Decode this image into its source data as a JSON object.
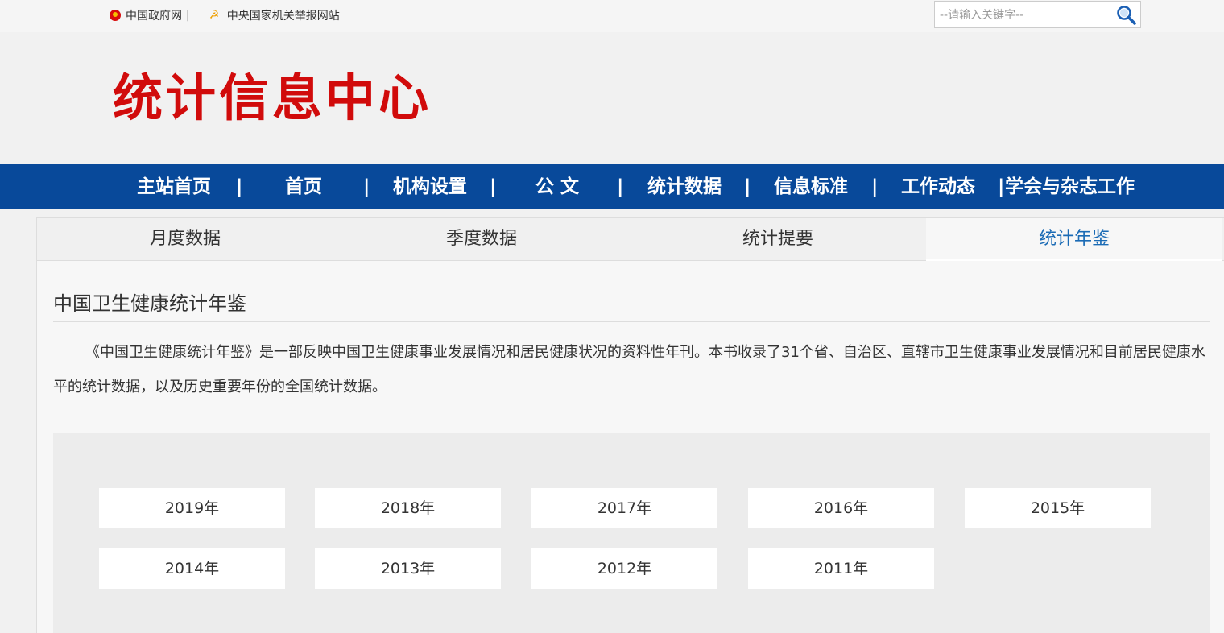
{
  "topbar": {
    "link1": "中国政府网",
    "separator": "|",
    "link2": "中央国家机关举报网站",
    "search_placeholder": "--请输入关键字--"
  },
  "header": {
    "logo_text": "统计信息中心"
  },
  "nav": {
    "items": [
      "主站首页",
      "首页",
      "机构设置",
      "公 文",
      "统计数据",
      "信息标准",
      "工作动态",
      "学会与杂志工作"
    ],
    "separator": "|"
  },
  "subtabs": {
    "items": [
      "月度数据",
      "季度数据",
      "统计提要",
      "统计年鉴"
    ],
    "active_index": 3
  },
  "content": {
    "title": "中国卫生健康统计年鉴",
    "description": "《中国卫生健康统计年鉴》是一部反映中国卫生健康事业发展情况和居民健康状况的资料性年刊。本书收录了31个省、自治区、直辖市卫生健康事业发展情况和目前居民健康水平的统计数据，以及历史重要年份的全国统计数据。"
  },
  "years": [
    "2019年",
    "2018年",
    "2017年",
    "2016年",
    "2015年",
    "2014年",
    "2013年",
    "2012年",
    "2011年"
  ],
  "colors": {
    "nav_bg": "#08499a",
    "logo_red": "#d10b0b",
    "active_tab": "#1b6bb5"
  }
}
